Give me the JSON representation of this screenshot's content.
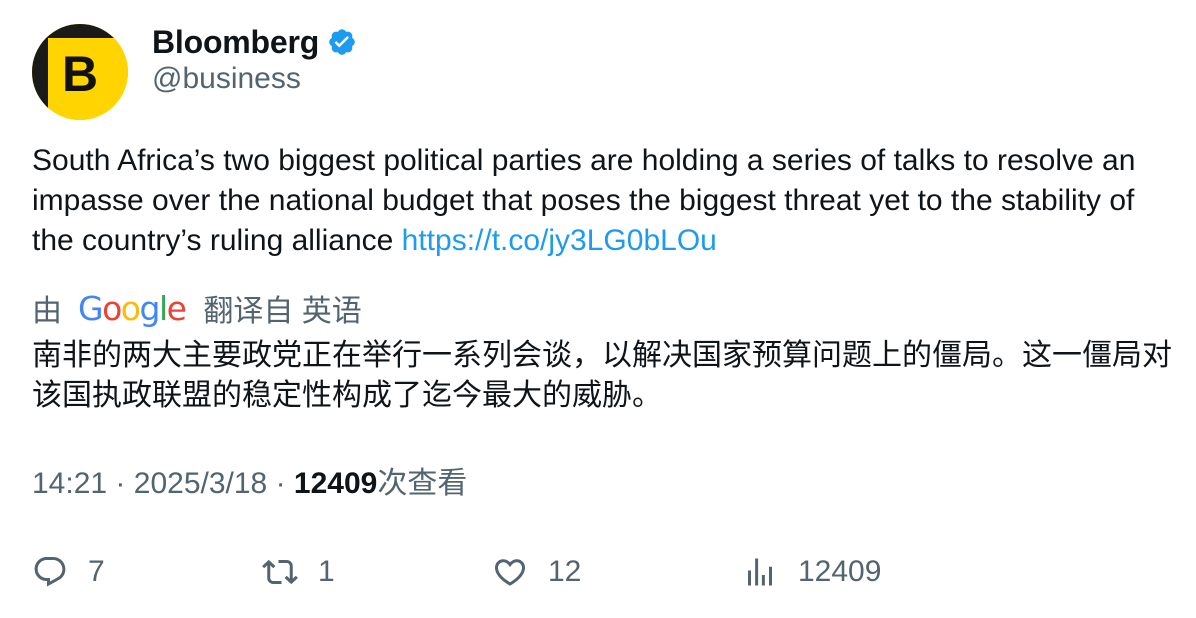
{
  "author": {
    "display_name": "Bloomberg",
    "handle": "@business",
    "verified": true,
    "avatar_letter": "B",
    "avatar_bg": "#ffd400",
    "verified_color": "#1d9bf0"
  },
  "tweet": {
    "text": "South Africa’s two biggest political parties are holding a series of talks to resolve an impasse over the national budget that poses the biggest threat yet to the stability of the country’s ruling alliance ",
    "link": "https://t.co/jy3LG0bLOu"
  },
  "translation": {
    "prefix": "由",
    "provider": "Google",
    "suffix": "翻译自 英语",
    "text": "南非的两大主要政党正在举行一系列会谈，以解决国家预算问题上的僵局。这一僵局对该国执政联盟的稳定性构成了迄今最大的威胁。"
  },
  "meta": {
    "time": "14:21",
    "separator": "·",
    "date": "2025/3/18",
    "views_count": "12409",
    "views_label": "次查看"
  },
  "actions": {
    "replies": "7",
    "retweets": "1",
    "likes": "12",
    "views": "12409"
  }
}
